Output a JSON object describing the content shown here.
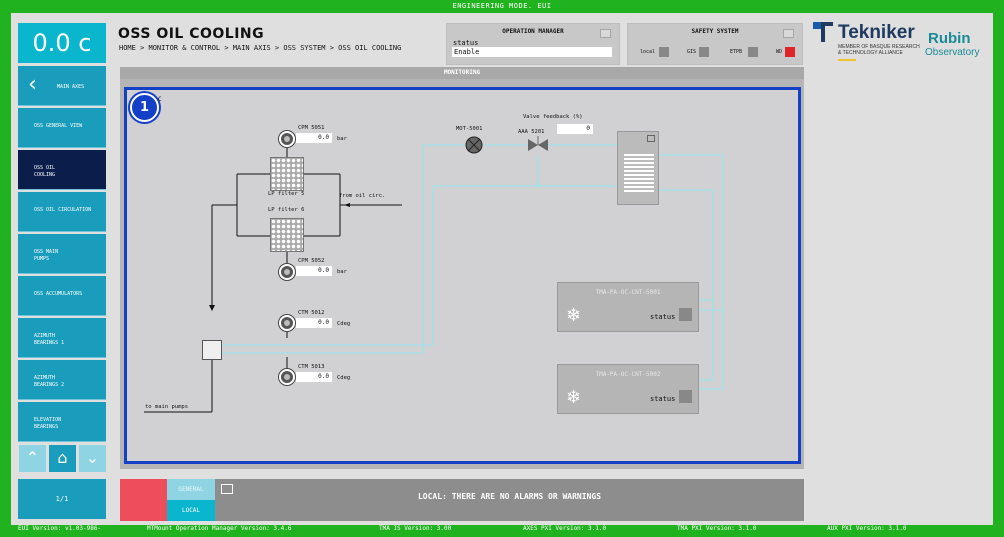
{
  "window": {
    "title": "ENGINEERING MODE. EUI"
  },
  "speed_display": {
    "value": "0.0 c"
  },
  "sidebar": {
    "items": [
      {
        "label": "MAIN AXES",
        "icon": "chevron-left-icon"
      },
      {
        "label": "OSS GENERAL VIEW"
      },
      {
        "label": "OSS OIL COOLING",
        "active": true
      },
      {
        "label": "OSS OIL CIRCULATION"
      },
      {
        "label": "OSS MAIN PUMPS"
      },
      {
        "label": "OSS ACCUMULATORS"
      },
      {
        "label": "AZIMUTH BEARINGS 1"
      },
      {
        "label": "AZIMUTH BEARINGS 2"
      },
      {
        "label": "ELEVATION BEARINGS"
      }
    ],
    "up_icon": "chevron-up-icon",
    "home_icon": "home-icon",
    "down_icon": "chevron-down-icon",
    "page": "1/1"
  },
  "header": {
    "title": "OSS OIL COOLING",
    "breadcrumb": "HOME > MONITOR & CONTROL > MAIN AXIS > OSS SYSTEM > OSS OIL COOLING"
  },
  "operation_manager": {
    "title": "OPERATION MANAGER",
    "status_label": "status",
    "status_value": "Enable"
  },
  "safety_system": {
    "title": "SAFETY SYSTEM",
    "items": [
      {
        "label": "local",
        "color": "#888888"
      },
      {
        "label": "GIS",
        "color": "#888888"
      },
      {
        "label": "ETPB",
        "color": "#888888"
      },
      {
        "label": "WD",
        "color": "#e0242a"
      }
    ]
  },
  "logos": {
    "tekniker": "Tekniker",
    "tekniker_sub": [
      "MEMBER OF BASQUE RESEARCH",
      "& TECHNOLOGY ALLIANCE"
    ],
    "rubin": "Rubin",
    "rubin_sub": "Observatory"
  },
  "monitoring": {
    "title": "MONITORING",
    "badge": "1",
    "corner_label": "C",
    "sensors": {
      "cpm5051": {
        "name": "CPM 5051",
        "value": "0.0",
        "unit": "bar"
      },
      "cpm5052": {
        "name": "CPM 5052",
        "value": "0.0",
        "unit": "bar"
      },
      "ctm5012": {
        "name": "CTM 5012",
        "value": "0.0",
        "unit": "Cdeg"
      },
      "ctm5013": {
        "name": "CTM 5013",
        "value": "0.0",
        "unit": "Cdeg"
      }
    },
    "filters": {
      "lp5": "LP filter 5",
      "lp6": "LP filter 6"
    },
    "from_oil": "from oil circ.",
    "to_pumps": "to main pumps",
    "motor": "MOT-5001",
    "valve": {
      "name": "AAA 5201",
      "feedback_label": "Valve feedback (%)",
      "feedback_value": "0"
    },
    "chillers": [
      {
        "name": "TMA-PA-OC-CNT-5001",
        "status_label": "status"
      },
      {
        "name": "TMA-PA-OC-CNT-5002",
        "status_label": "status"
      }
    ]
  },
  "alarms": {
    "tab_general": "GENERAL",
    "tab_local": "LOCAL",
    "message": "LOCAL: THERE ARE NO ALARMS OR WARNINGS"
  },
  "footer": {
    "eui": "EUI Version: v1.03-986-",
    "mtmount": "MTMount Operation Manager Version: 3.4.6",
    "tma_is": "TMA IS Version: 3.00",
    "axes_pxi": "AXES PXI Version: 3.1.0",
    "tma_pxi": "TMA PXI Version: 3.1.0",
    "aux_pxi": "AUX PXI Version: 3.1.0"
  }
}
